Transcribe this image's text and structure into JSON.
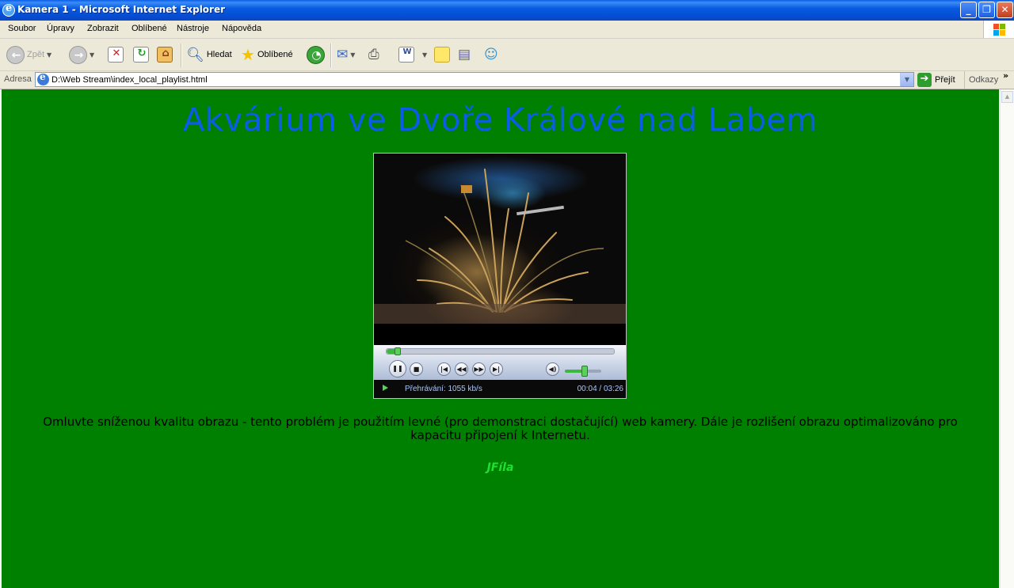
{
  "window": {
    "title": "Kamera 1 - Microsoft Internet Explorer"
  },
  "menu": [
    "Soubor",
    "Úpravy",
    "Zobrazit",
    "Oblíbené",
    "Nástroje",
    "Nápověda"
  ],
  "toolbar": {
    "back_label": "Zpět",
    "search_label": "Hledat",
    "favorites_label": "Oblíbené"
  },
  "address": {
    "label": "Adresa",
    "value": "D:\\Web Stream\\index_local_playlist.html",
    "go_label": "Přejít",
    "links_label": "Odkazy"
  },
  "page": {
    "heading": "Akvárium ve Dvoře Králové nad Labem",
    "note": "Omluvte sníženou kvalitu obrazu - tento problém je použitím levné (pro demonstraci dostačující) web kamery. Dále je rozlišení obrazu optimalizováno pro kapacitu připojení k Internetu.",
    "author": "JFíla"
  },
  "player": {
    "status": "Přehrávání: 1055 kb/s",
    "time": "00:04 / 03:26",
    "progress_fraction": 0.02,
    "volume_fraction": 0.55
  },
  "colors": {
    "page_bg": "#008000",
    "heading": "#0d5ce8",
    "author": "#1fe030"
  }
}
